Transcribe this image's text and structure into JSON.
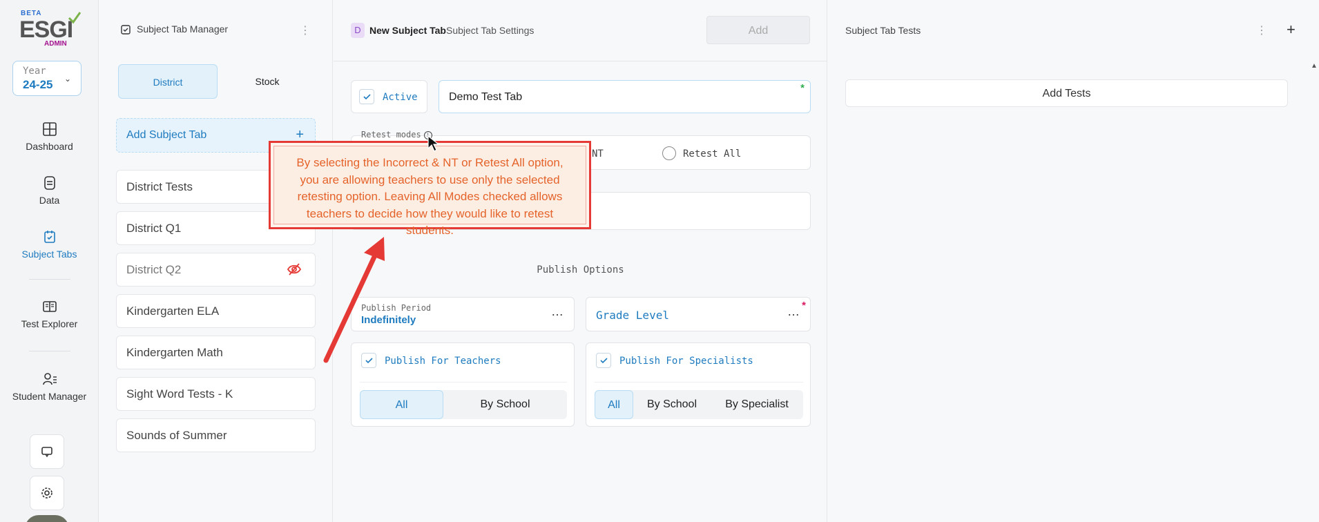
{
  "nav": {
    "logo": {
      "beta": "BETA",
      "esgi": "ESGI",
      "admin": "ADMIN"
    },
    "year": {
      "label": "Year",
      "value": "24-25"
    },
    "items": [
      {
        "label": "Dashboard",
        "icon": "grid-icon"
      },
      {
        "label": "Data",
        "icon": "data-icon"
      },
      {
        "label": "Subject Tabs",
        "icon": "subject-tabs-icon",
        "active": true
      },
      {
        "label": "Test Explorer",
        "icon": "book-icon"
      },
      {
        "label": "Student Manager",
        "icon": "student-manager-icon"
      }
    ]
  },
  "tab_manager": {
    "title": "Subject Tab Manager",
    "toggle": {
      "district": "District",
      "stock": "Stock"
    },
    "add_label": "Add Subject Tab",
    "add_plus": "+",
    "tabs": [
      {
        "label": "District Tests"
      },
      {
        "label": "District Q1"
      },
      {
        "label": "District Q2",
        "hidden": true
      },
      {
        "label": "Kindergarten ELA"
      },
      {
        "label": "Kindergarten Math"
      },
      {
        "label": "Sight Word Tests - K"
      },
      {
        "label": "Sounds of Summer"
      }
    ]
  },
  "settings": {
    "badge": "D",
    "title": "New Subject Tab",
    "subtitle": "Subject Tab Settings",
    "add_button": "Add",
    "active_label": "Active",
    "name_value": "Demo Test Tab",
    "required_mark": "*",
    "retest_label": "Retest modes",
    "retest_info": "i",
    "retest_nt_fragment": "NT",
    "retest_all": "Retest All",
    "publish_options": "Publish Options",
    "publish_period": {
      "label": "Publish Period",
      "value": "Indefinitely"
    },
    "grade_level": "Grade Level",
    "more": "…",
    "teachers": {
      "label": "Publish For Teachers",
      "options": [
        "All",
        "By School"
      ],
      "selected": "All"
    },
    "specialists": {
      "label": "Publish For Specialists",
      "options": [
        "All",
        "By School",
        "By Specialist"
      ],
      "selected": "All"
    }
  },
  "tests_panel": {
    "title": "Subject Tab Tests",
    "plus": "+",
    "add_tests": "Add Tests"
  },
  "annotation": {
    "text": "By selecting the Incorrect & NT or Retest All option, you are allowing teachers to use only the selected retesting option. Leaving All Modes checked allows teachers to decide how they would like to retest students."
  },
  "colors": {
    "accent": "#1e7bbf",
    "annotation_border": "#e53935",
    "annotation_text": "#e4632a",
    "required_green": "#2eaf4f",
    "required_red": "#d81b60",
    "hidden_icon": "#e53935"
  }
}
